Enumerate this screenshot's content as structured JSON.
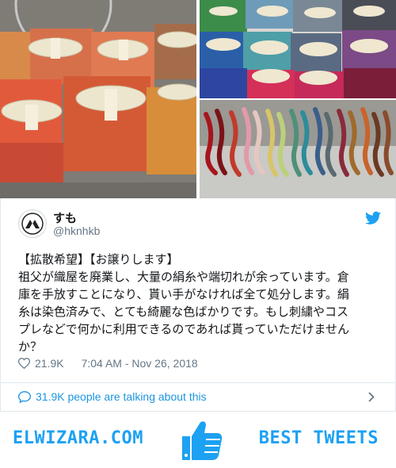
{
  "tweet": {
    "display_name": "すも",
    "handle": "@hknhkb",
    "text_lines": [
      "【拡散希望】【お譲りします】",
      "祖父が織屋を廃業し、大量の絹糸や端切れが余っています。倉",
      "庫を手放すことになり、貰い手がなければ全て処分します。絹",
      "糸は染色済みで、とても綺麗な色ばかりです。もし刺繍やコス",
      "プレなどで何かに利用できるのであれば貰っていただけません",
      "か？"
    ],
    "likes": "21.9K",
    "timestamp": "7:04 AM - Nov 26, 2018",
    "talking": "31.9K people are talking about this"
  },
  "banner": {
    "site": "ELWIZARA.COM",
    "tagline": "BEST TWEETS"
  },
  "colors": {
    "twitter_blue": "#1da1f2",
    "link_blue": "#1b95e0",
    "muted": "#657786"
  },
  "icons": [
    "mountain-avatar-icon",
    "twitter-bird-icon",
    "heart-icon",
    "speech-bubble-icon",
    "chevron-right-icon",
    "thumbs-up-icon"
  ]
}
